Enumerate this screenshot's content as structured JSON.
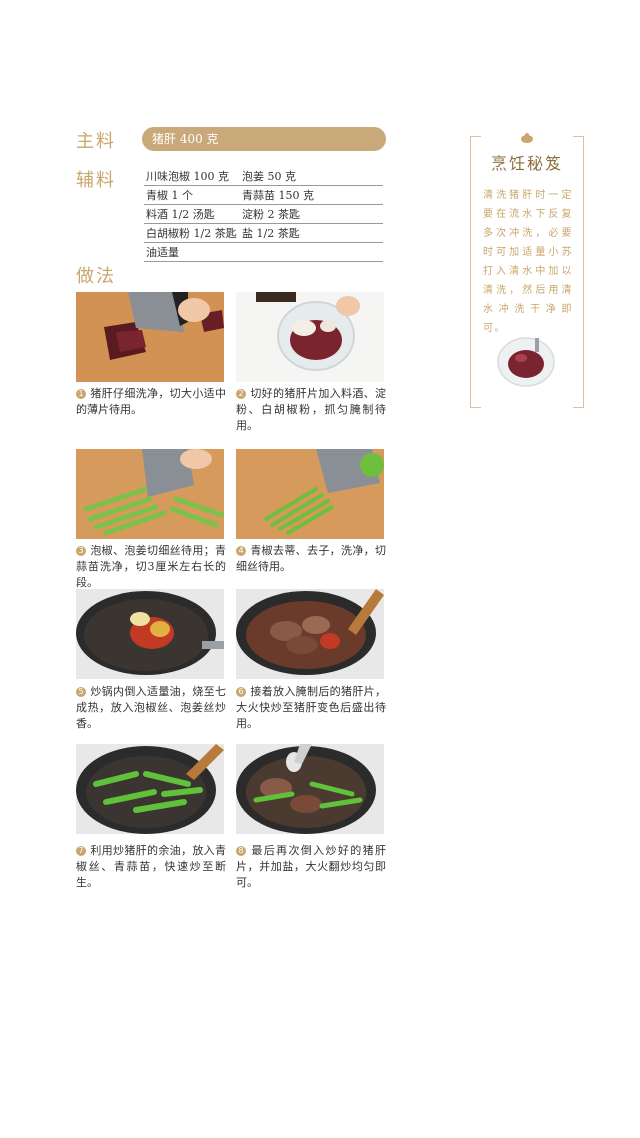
{
  "main_label": "主料",
  "main_ingredient": "猪肝 400 克",
  "aux_label": "辅料",
  "aux_ingredients": [
    [
      "川味泡椒 100 克",
      "泡姜 50 克"
    ],
    [
      "青椒 1 个",
      "青蒜苗 150 克"
    ],
    [
      "料酒 1/2 汤匙",
      "淀粉 2 茶匙"
    ],
    [
      "白胡椒粉 1/2 茶匙",
      "盐 1/2 茶匙"
    ],
    [
      "油适量",
      ""
    ]
  ],
  "method_label": "做法",
  "steps": [
    {
      "num": "1",
      "text": "猪肝仔细洗净，切大小适中的薄片待用。"
    },
    {
      "num": "2",
      "text": "切好的猪肝片加入料酒、淀粉、白胡椒粉，抓匀腌制待用。"
    },
    {
      "num": "3",
      "text": "泡椒、泡姜切细丝待用；青蒜苗洗净，切3厘米左右长的段。"
    },
    {
      "num": "4",
      "text": "青椒去蒂、去子，洗净，切细丝待用。"
    },
    {
      "num": "5",
      "text": "炒锅内倒入适量油，烧至七成热，放入泡椒丝、泡姜丝炒香。"
    },
    {
      "num": "6",
      "text": "接着放入腌制后的猪肝片，大火快炒至猪肝变色后盛出待用。"
    },
    {
      "num": "7",
      "text": "利用炒猪肝的余油，放入青椒丝、青蒜苗，快速炒至断生。"
    },
    {
      "num": "8",
      "text": "最后再次倒入炒好的猪肝片，并加盐，大火翻炒均匀即可。"
    }
  ],
  "tip": {
    "title": "烹饪秘笈",
    "text": "清洗猪肝时一定要在流水下反复多次冲洗，必要时可加适量小苏打入清水中加以清洗，然后用清水冲洗干净即可。"
  }
}
